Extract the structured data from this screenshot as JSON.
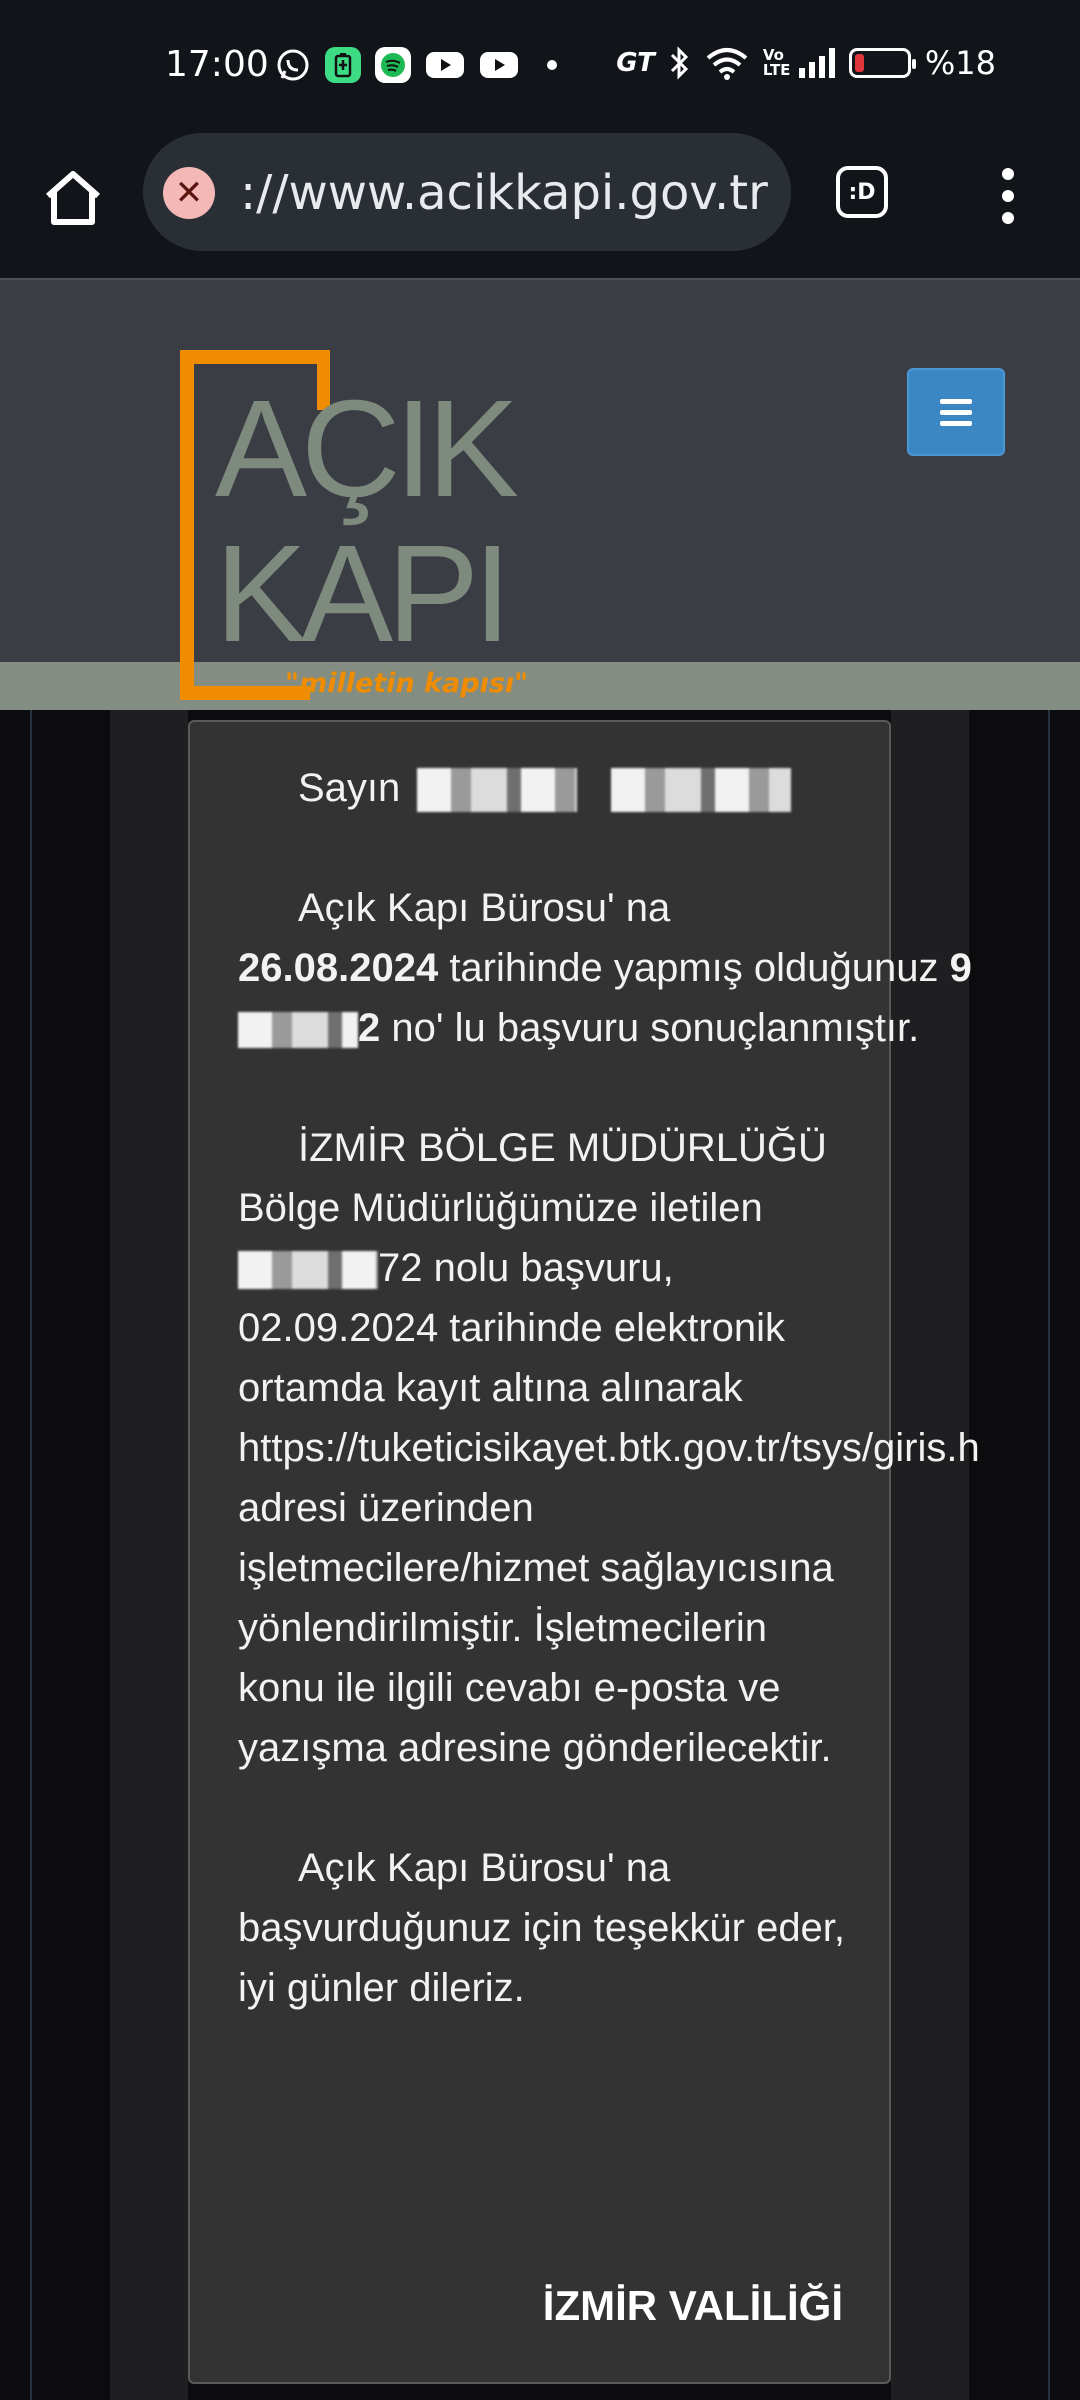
{
  "status_bar": {
    "time": "17:00",
    "notification_icons": [
      "whatsapp-icon",
      "battery-saver-icon",
      "spotify-icon",
      "youtube-icon",
      "youtube-icon"
    ],
    "network_label": "GT",
    "volte_label": "Vo LTE",
    "battery_percent": "%18",
    "battery_level": 0.18,
    "battery_color": "#e0363b"
  },
  "browser": {
    "url": "://www.acikkapi.gov.tr",
    "tab_label": ":D"
  },
  "site": {
    "logo_line1": "AÇIK",
    "logo_line2": "KAPI",
    "logo_slogan": "\"milletin kapısı\"",
    "logo_color": "#f08c00",
    "header_color": "#3a3d44",
    "nav_button_color": "#3a87c4"
  },
  "message": {
    "salutation": "Sayın",
    "p1_intro": "Açık Kapı Bürosu' na",
    "p1_date": "26.08.2024",
    "p1_mid": " tarihinde yapmış olduğunuz ",
    "p1_no_start": "9",
    "p1_no_end": "2",
    "p1_end": " no' lu başvuru sonuçlanmıştır.",
    "p2_unit": "İZMİR BÖLGE MÜDÜRLÜĞÜ",
    "p2_line1": "Bölge Müdürlüğümüze iletilen",
    "p2_no_end": "72",
    "p2_rest": " nolu başvuru, 02.09.2024 tarihinde elektronik ortamda kayıt altına alınarak",
    "p2_url": "https://tuketicisikayet.btk.gov.tr/tsys/giris.h",
    "p2_tail": "adresi üzerinden işletmecilere/hizmet sağlayıcısına yönlendirilmiştir. İşletmecilerin konu ile ilgili cevabı e-posta ve yazışma adresine gönderilecektir.",
    "p3": "Açık Kapı Bürosu' na başvurduğunuz için teşekkür eder, iyi günler dileriz.",
    "signature": "İZMİR VALİLİĞİ"
  }
}
